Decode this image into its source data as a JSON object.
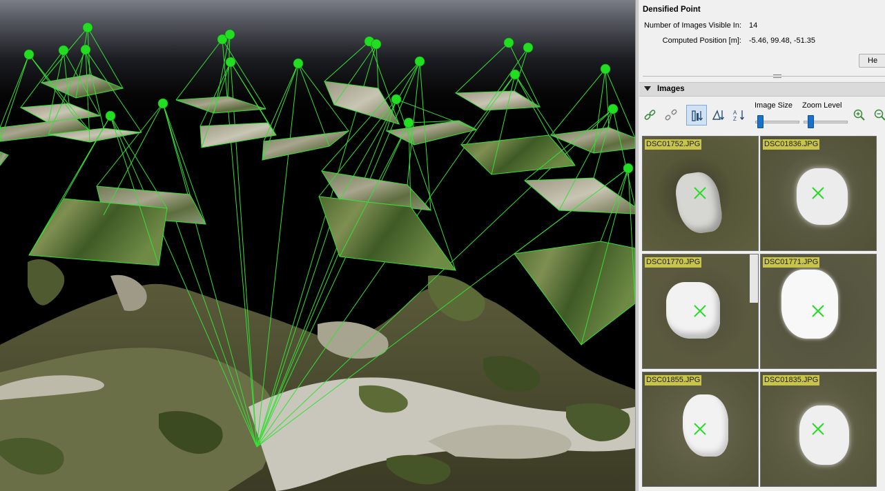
{
  "properties": {
    "section_title": "Densified Point",
    "rows": [
      {
        "label": "Number of Images Visible In:",
        "value": "14"
      },
      {
        "label": "Computed Position [m]:",
        "value": "-5.46, 99.48, -51.35"
      }
    ],
    "help_button": "He"
  },
  "images_panel": {
    "title": "Images",
    "image_size_label": "Image Size",
    "zoom_level_label": "Zoom Level",
    "image_size_value": 0.06,
    "zoom_level_value": 0.11,
    "toolbar_icons": [
      "link-icon",
      "unlink-icon",
      "sort-visibility-icon",
      "sort-triangle-icon",
      "sort-alpha-icon",
      "zoom-in-icon",
      "zoom-out-icon"
    ],
    "thumbnails": [
      {
        "name": "DSC01752.JPG"
      },
      {
        "name": "DSC01836.JPG"
      },
      {
        "name": "DSC01770.JPG"
      },
      {
        "name": "DSC01771.JPG"
      },
      {
        "name": "DSC01855.JPG"
      },
      {
        "name": "DSC01835.JPG"
      }
    ]
  },
  "colors": {
    "camera_green": "#22dd22",
    "ray_green": "#35e035",
    "caption_bg": "#c8c44a",
    "active_tool": "#cfe1f3",
    "slider_blue": "#1b72c9"
  }
}
